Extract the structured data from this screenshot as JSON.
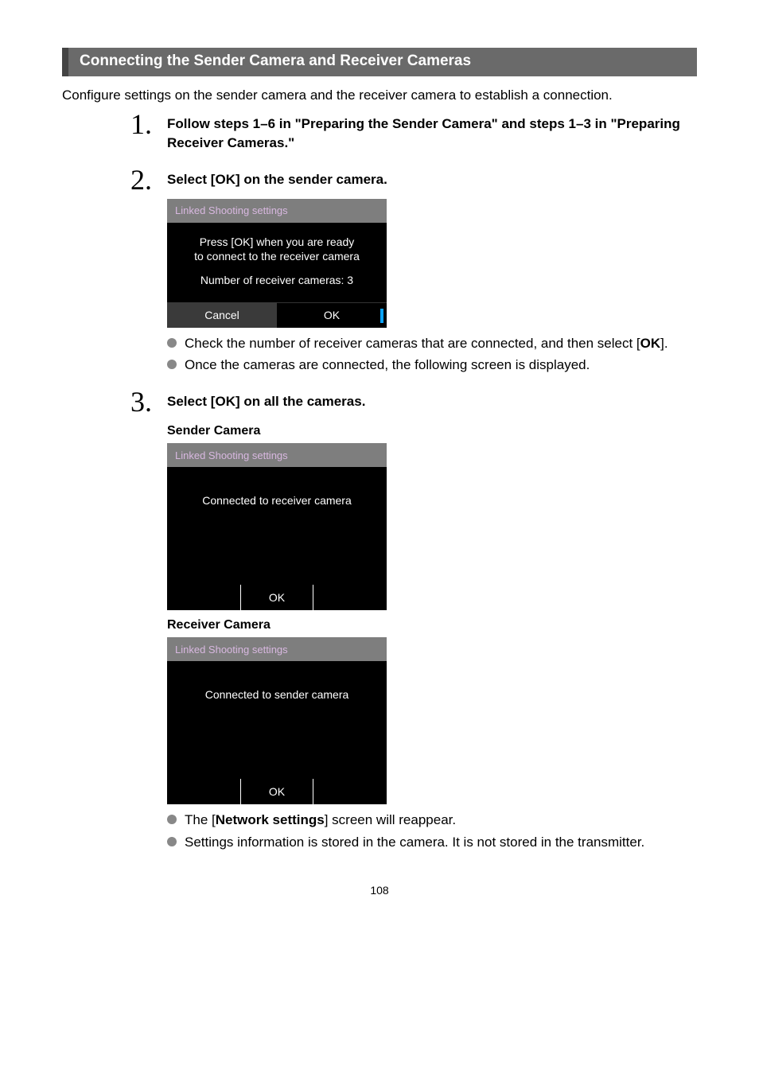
{
  "section_title": "Connecting the Sender Camera and Receiver Cameras",
  "intro": "Configure settings on the sender camera and the receiver camera to establish a connection.",
  "steps": [
    {
      "num": "1.",
      "title": "Follow steps 1–6 in \"Preparing the Sender Camera\" and steps 1–3 in \"Preparing Receiver Cameras.\""
    },
    {
      "num": "2.",
      "title": "Select [OK] on the sender camera.",
      "screenshot": {
        "header": "Linked Shooting settings",
        "line1": "Press [OK] when you are ready",
        "line2": "to connect to the receiver camera",
        "line3": "Number of receiver cameras: 3",
        "btn_left": "Cancel",
        "btn_right": "OK"
      },
      "bullets": [
        {
          "pre": "Check the number of receiver cameras that are connected, and then select [",
          "bold": "OK",
          "post": "]."
        },
        {
          "pre": "Once the cameras are connected, the following screen is displayed.",
          "bold": "",
          "post": ""
        }
      ]
    },
    {
      "num": "3.",
      "title": "Select [OK] on all the cameras.",
      "sub1": {
        "label": "Sender Camera",
        "header": "Linked Shooting settings",
        "body": "Connected to receiver camera",
        "btn": "OK"
      },
      "sub2": {
        "label": "Receiver Camera",
        "header": "Linked Shooting settings",
        "body": "Connected to sender camera",
        "btn": "OK"
      },
      "bullets": [
        {
          "pre": "The [",
          "bold": "Network settings",
          "post": "] screen will reappear."
        },
        {
          "pre": "Settings information is stored in the camera. It is not stored in the transmitter.",
          "bold": "",
          "post": ""
        }
      ]
    }
  ],
  "page_number": "108"
}
